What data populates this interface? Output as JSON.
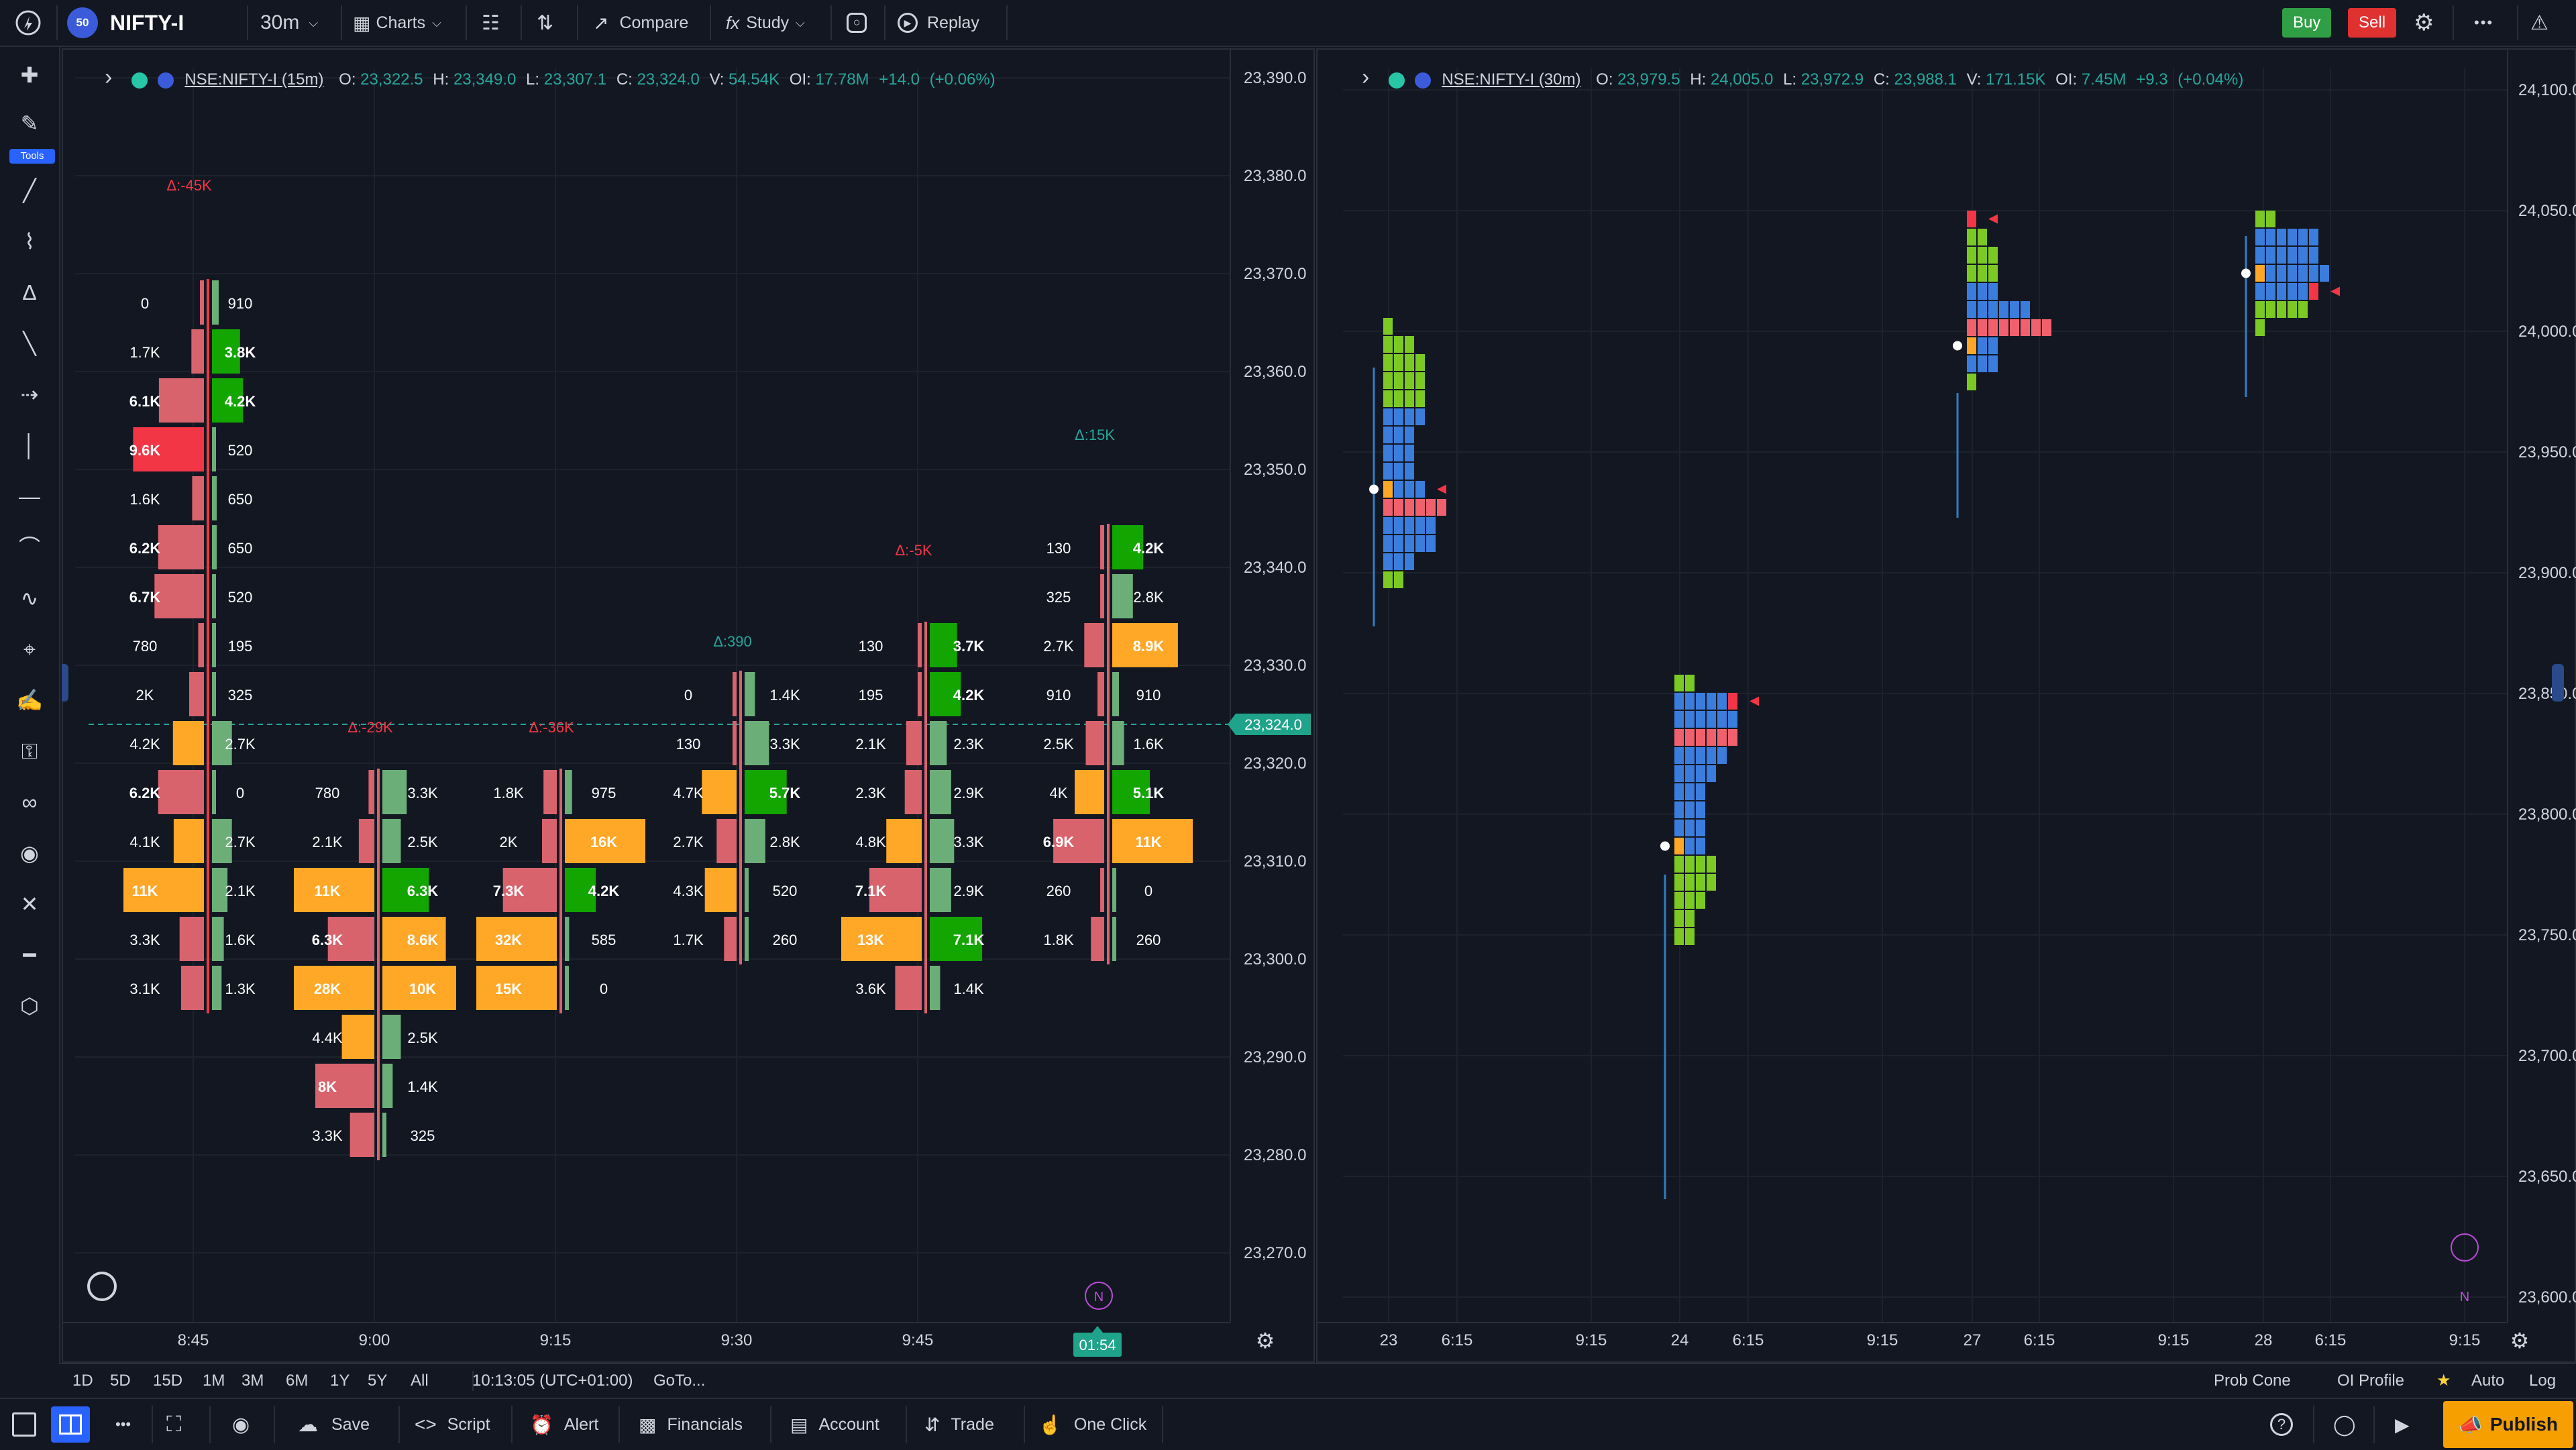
{
  "header": {
    "symbol": "NIFTY-I",
    "symbol_badge": "50",
    "interval": "30m",
    "charts_label": "Charts",
    "compare_label": "Compare",
    "study_label": "Study",
    "replay_label": "Replay",
    "buy_label": "Buy",
    "sell_label": "Sell",
    "more_label": "•••"
  },
  "left_toolbar": {
    "tools_badge": "Tools",
    "icons": [
      "crosshair-icon",
      "brush-icon",
      "trendline-icon",
      "polyline-icon",
      "pitchfork-icon",
      "ray-icon",
      "extended-line-icon",
      "vertical-line-icon",
      "horizontal-line-icon",
      "curve-icon",
      "path-icon",
      "mouse-icon",
      "measure-pen-icon",
      "lock-icon",
      "link-icon",
      "eye-icon",
      "trash-icon",
      "ruler-icon",
      "magnet-icon"
    ]
  },
  "left_chart": {
    "legend": {
      "symbol": "NSE:NIFTY-I (15m)",
      "o_label": "O:",
      "o": "23,322.5",
      "h_label": "H:",
      "h": "23,349.0",
      "l_label": "L:",
      "l": "23,307.1",
      "c_label": "C:",
      "c": "23,324.0",
      "v_label": "V:",
      "v": "54.54K",
      "oi_label": "OI:",
      "oi": "17.78M",
      "change": "+14.0",
      "change_pct": "(+0.06%)"
    },
    "price_labels": [
      "23,390.0",
      "23,380.0",
      "23,370.0",
      "23,360.0",
      "23,350.0",
      "23,340.0",
      "23,330.0",
      "23,320.0",
      "23,310.0",
      "23,300.0",
      "23,290.0",
      "23,280.0",
      "23,270.0"
    ],
    "current_price": "23,324.0",
    "time_labels": [
      "8:45",
      "9:00",
      "9:15",
      "9:30",
      "9:45"
    ],
    "countdown": "01:54",
    "session_marker": "N",
    "deltas": [
      "Δ:-45K",
      "Δ:-29K",
      "Δ:-36K",
      "Δ:390",
      "Δ:-5K",
      "Δ:15K"
    ],
    "columns": [
      {
        "sell": [
          "0",
          "1.7K",
          "6.1K",
          "9.6K",
          "1.6K",
          "6.2K",
          "6.7K",
          "780",
          "2K",
          "4.2K",
          "6.2K",
          "4.1K",
          "11K",
          "3.3K",
          "3.1K"
        ],
        "buy": [
          "910",
          "3.8K",
          "4.2K",
          "520",
          "650",
          "650",
          "520",
          "195",
          "325",
          "2.7K",
          "0",
          "2.7K",
          "2.1K",
          "1.6K",
          "1.3K"
        ]
      },
      {
        "sell": [
          "780",
          "2.1K",
          "11K",
          "6.3K",
          "28K",
          "4.4K",
          "8K",
          "3.3K"
        ],
        "buy": [
          "3.3K",
          "2.5K",
          "6.3K",
          "8.6K",
          "10K",
          "2.5K",
          "1.4K",
          "325"
        ]
      },
      {
        "sell": [
          "1.8K",
          "2K",
          "7.3K",
          "32K",
          "15K"
        ],
        "buy": [
          "975",
          "16K",
          "4.2K",
          "585",
          "0"
        ]
      },
      {
        "sell": [
          "0",
          "130",
          "4.7K",
          "2.7K",
          "4.3K",
          "1.7K"
        ],
        "buy": [
          "1.4K",
          "3.3K",
          "5.7K",
          "2.8K",
          "520",
          "260"
        ]
      },
      {
        "sell": [
          "130",
          "195",
          "2.1K",
          "2.3K",
          "4.8K",
          "7.1K",
          "13K",
          "3.6K"
        ],
        "buy": [
          "3.7K",
          "4.2K",
          "2.3K",
          "2.9K",
          "3.3K",
          "2.9K",
          "7.1K",
          "1.4K"
        ]
      },
      {
        "sell": [
          "130",
          "325",
          "2.7K",
          "910",
          "2.5K",
          "4K",
          "6.9K",
          "260",
          "1.8K"
        ],
        "buy": [
          "4.2K",
          "2.8K",
          "8.9K",
          "910",
          "1.6K",
          "5.1K",
          "11K",
          "0",
          "260"
        ]
      }
    ]
  },
  "right_chart": {
    "legend": {
      "symbol": "NSE:NIFTY-I (30m)",
      "o_label": "O:",
      "o": "23,979.5",
      "h_label": "H:",
      "h": "24,005.0",
      "l_label": "L:",
      "l": "23,972.9",
      "c_label": "C:",
      "c": "23,988.1",
      "v_label": "V:",
      "v": "171.15K",
      "oi_label": "OI:",
      "oi": "7.45M",
      "change": "+9.3",
      "change_pct": "(+0.04%)"
    },
    "price_labels": [
      "24,100.0",
      "24,050.0",
      "24,000.0",
      "23,950.0",
      "23,900.0",
      "23,850.0",
      "23,800.0",
      "23,750.0",
      "23,700.0",
      "23,650.0",
      "23,600.0"
    ],
    "time_labels": [
      "23",
      "6:15",
      "9:15",
      "24",
      "6:15",
      "9:15",
      "27",
      "6:15",
      "9:15",
      "28",
      "6:15",
      "9:15"
    ],
    "session_marker": "N"
  },
  "range_bar": {
    "ranges": [
      "1D",
      "5D",
      "15D",
      "1M",
      "3M",
      "6M",
      "1Y",
      "5Y",
      "All"
    ],
    "clock": "10:13:05 (UTC+01:00)",
    "goto": "GoTo...",
    "prob_cone": "Prob Cone",
    "oi_profile": "OI Profile",
    "auto": "Auto",
    "log": "Log"
  },
  "bottom_bar": {
    "save": "Save",
    "script": "Script",
    "alert": "Alert",
    "financials": "Financials",
    "account": "Account",
    "trade": "Trade",
    "one_click": "One Click",
    "publish": "Publish"
  },
  "colors": {
    "background": "#131722",
    "sell_red": "#f23645",
    "buy_green": "#13a500",
    "poc_orange": "#ffa726",
    "profile_blue": "#3b7ddd",
    "profile_green": "#7cc924",
    "profile_pink": "#f0616d",
    "muted_red": "#d9636d",
    "muted_green": "#6cae78",
    "accent_teal": "#26a69a"
  }
}
